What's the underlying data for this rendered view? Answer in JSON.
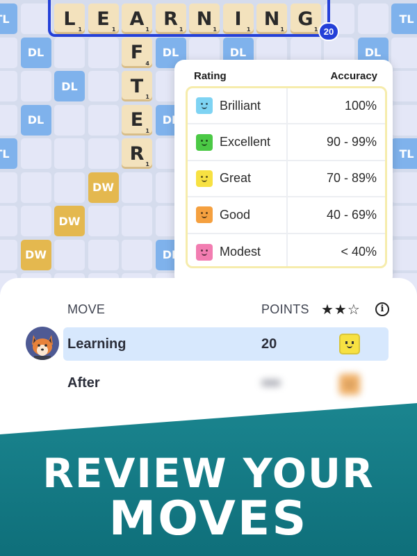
{
  "board": {
    "word": {
      "tiles": [
        {
          "letter": "L",
          "points": "1"
        },
        {
          "letter": "E",
          "points": "1"
        },
        {
          "letter": "A",
          "points": "1"
        },
        {
          "letter": "R",
          "points": "1"
        },
        {
          "letter": "N",
          "points": "1"
        },
        {
          "letter": "I",
          "points": "1"
        },
        {
          "letter": "N",
          "points": "1"
        },
        {
          "letter": "G",
          "points": "1"
        }
      ],
      "score": "20"
    },
    "vertical_tiles": [
      {
        "letter": "F",
        "points": "4"
      },
      {
        "letter": "T",
        "points": "1"
      },
      {
        "letter": "E",
        "points": "1"
      },
      {
        "letter": "R",
        "points": "1"
      }
    ],
    "premium_labels": {
      "dl": "DL",
      "tl": "TL",
      "dw": "DW"
    }
  },
  "rating_popover": {
    "rating_header": "Rating",
    "accuracy_header": "Accuracy",
    "rows": [
      {
        "name": "Brilliant",
        "accuracy": "100%",
        "color": "#7ed3f3"
      },
      {
        "name": "Excellent",
        "accuracy": "90 - 99%",
        "color": "#4bc945"
      },
      {
        "name": "Great",
        "accuracy": "70 - 89%",
        "color": "#f7e142"
      },
      {
        "name": "Good",
        "accuracy": "40 - 69%",
        "color": "#f5a03f"
      },
      {
        "name": "Modest",
        "accuracy": "< 40%",
        "color": "#f27db1"
      }
    ]
  },
  "moves_panel": {
    "move_header": "MOVE",
    "points_header": "POINTS",
    "star_rating": "★★☆",
    "info_icon": "i",
    "moves": [
      {
        "word": "Learning",
        "points": "20",
        "rating_color": "#f7e142"
      },
      {
        "word": "After",
        "points": "",
        "rating_color": "#f5a03f"
      }
    ]
  },
  "banner": {
    "line1": "REVIEW YOUR",
    "line2": "MOVES"
  },
  "colors": {
    "accent_blue": "#2440d8",
    "highlight_row": "#d7e8fd",
    "banner_teal": "#1b8690"
  }
}
